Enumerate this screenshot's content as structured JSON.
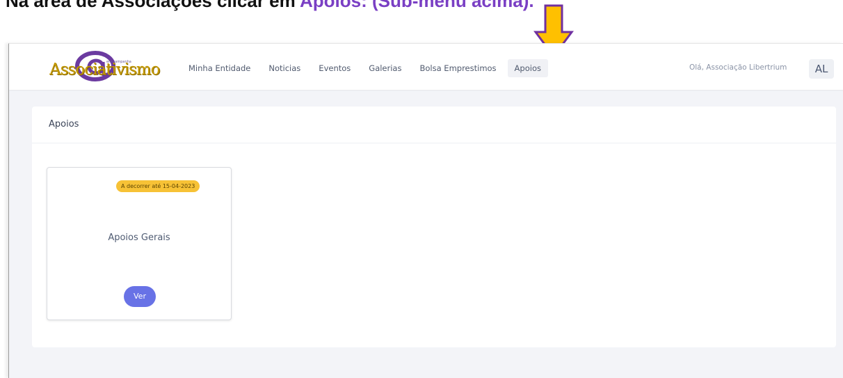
{
  "caption": {
    "text_before": "Na área de Associações clicar em ",
    "highlight": "Apoios: (Sub-menu acima).",
    "accent_color": "#7a3fc4"
  },
  "annotation": {
    "arrow_icon": "down-arrow-icon",
    "arrow_color": "#ffc000",
    "arrow_outline": "#7030a0"
  },
  "app": {
    "logo": {
      "text": "Associativismo",
      "tagline": "em campanha"
    },
    "nav": [
      {
        "label": "Minha Entidade",
        "active": false
      },
      {
        "label": "Noticias",
        "active": false
      },
      {
        "label": "Eventos",
        "active": false
      },
      {
        "label": "Galerias",
        "active": false
      },
      {
        "label": "Bolsa Emprestimos",
        "active": false
      },
      {
        "label": "Apoios",
        "active": true
      }
    ],
    "user": {
      "greeting": "Olá, Associação Libertrium",
      "initials": "AL"
    }
  },
  "page": {
    "title": "Apoios",
    "cards": [
      {
        "badge": "A decorrer até 15-04-2023",
        "badge_color": "#f7c236",
        "title": "Apoios Gerais",
        "button_label": "Ver",
        "button_color": "#6872e6"
      }
    ]
  }
}
